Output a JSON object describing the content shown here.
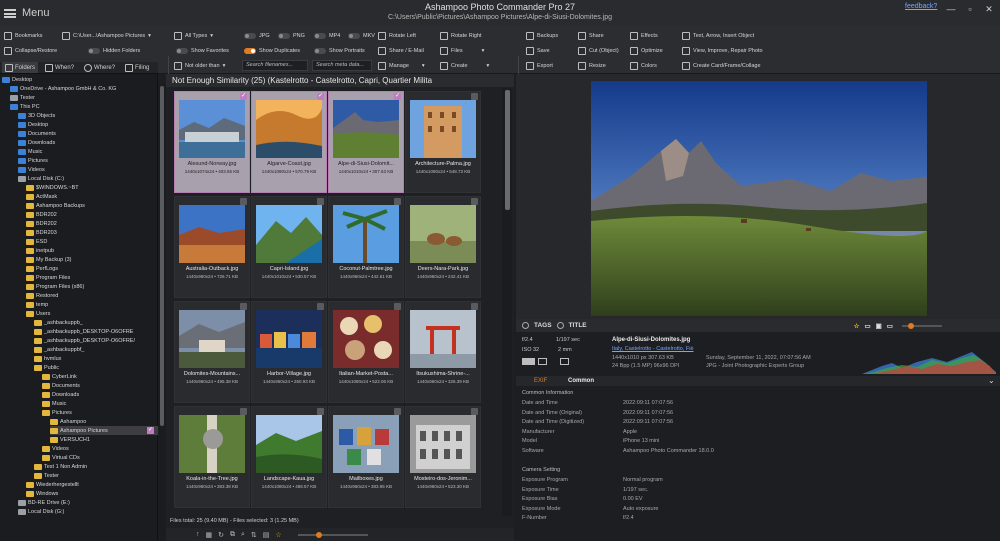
{
  "app": {
    "menu_label": "Menu",
    "title": "Ashampoo Photo Commander Pro 27",
    "path": "C:\\Users\\Public\\Pictures\\Ashampoo Pictures\\Alpe-di-Siusi-Dolomites.jpg",
    "feedback": "feedback?"
  },
  "toolbar": {
    "col1": [
      "Bookmarks",
      "Collapse/Restore"
    ],
    "col1b": [
      "C:\\User...\\Ashampoo Pictures",
      "Hidden Folders"
    ],
    "types": "All Types",
    "toggles1": [
      "JPG",
      "PNG",
      "MP4",
      "MKV"
    ],
    "show_favorites": "Show Favorites",
    "show_duplicates": "Show Duplicates",
    "show_portraits": "Show Portraits",
    "not_older_than": "Not older than",
    "search_filenames": "Search filenames...",
    "search_meta": "Search meta data...",
    "rotate_left": "Rotate Left",
    "rotate_right": "Rotate Right",
    "share_email": "Share / E-Mail",
    "files": "Files",
    "manage": "Manage",
    "create": "Create",
    "backups": "Backups",
    "share": "Share",
    "effects": "Effects",
    "save": "Save",
    "cut_object": "Cut (Object)",
    "optimize": "Optimize",
    "export": "Export",
    "resize": "Resize",
    "colors": "Colors",
    "text_arrow": "Text, Arrow, Insert Object",
    "view_improve": "View, Improve, Repair Photo",
    "create_card": "Create Card/Frame/Collage"
  },
  "tree": {
    "tabs": [
      "Folders",
      "When?",
      "Where?",
      "Filing"
    ],
    "items": [
      {
        "label": "Desktop",
        "indent": 0,
        "kind": "blue"
      },
      {
        "label": "OneDrive - Ashampoo GmbH & Co. KG",
        "indent": 1,
        "kind": "blue"
      },
      {
        "label": "Tester",
        "indent": 1,
        "kind": "gray"
      },
      {
        "label": "This PC",
        "indent": 1,
        "kind": "blue"
      },
      {
        "label": "3D Objects",
        "indent": 2,
        "kind": "blue"
      },
      {
        "label": "Desktop",
        "indent": 2,
        "kind": "blue"
      },
      {
        "label": "Documents",
        "indent": 2,
        "kind": "blue"
      },
      {
        "label": "Downloads",
        "indent": 2,
        "kind": "blue"
      },
      {
        "label": "Music",
        "indent": 2,
        "kind": "blue"
      },
      {
        "label": "Pictures",
        "indent": 2,
        "kind": "blue"
      },
      {
        "label": "Videos",
        "indent": 2,
        "kind": "blue"
      },
      {
        "label": "Local Disk (C:)",
        "indent": 2,
        "kind": "gray"
      },
      {
        "label": "$WINDOWS.~BT",
        "indent": 3,
        "kind": "yellow"
      },
      {
        "label": "ActMask",
        "indent": 3,
        "kind": "yellow"
      },
      {
        "label": "Ashampoo Backups",
        "indent": 3,
        "kind": "yellow"
      },
      {
        "label": "BDR202",
        "indent": 3,
        "kind": "yellow"
      },
      {
        "label": "BDR202",
        "indent": 3,
        "kind": "yellow"
      },
      {
        "label": "BDR203",
        "indent": 3,
        "kind": "yellow"
      },
      {
        "label": "ESD",
        "indent": 3,
        "kind": "yellow"
      },
      {
        "label": "inetpub",
        "indent": 3,
        "kind": "yellow"
      },
      {
        "label": "My Backup (3)",
        "indent": 3,
        "kind": "yellow"
      },
      {
        "label": "PerfLogs",
        "indent": 3,
        "kind": "yellow"
      },
      {
        "label": "Program Files",
        "indent": 3,
        "kind": "yellow"
      },
      {
        "label": "Program Files (x86)",
        "indent": 3,
        "kind": "yellow"
      },
      {
        "label": "Restored",
        "indent": 3,
        "kind": "yellow"
      },
      {
        "label": "temp",
        "indent": 3,
        "kind": "yellow"
      },
      {
        "label": "Users",
        "indent": 3,
        "kind": "yellow"
      },
      {
        "label": "_ashbackuppb_",
        "indent": 4,
        "kind": "yellow"
      },
      {
        "label": "_ashbackuppb_DESKTOP-O6OFRE",
        "indent": 4,
        "kind": "yellow"
      },
      {
        "label": "_ashbackuppb_DESKTOP-O6OFRE/",
        "indent": 4,
        "kind": "yellow"
      },
      {
        "label": "_ashbackuppbf_",
        "indent": 4,
        "kind": "yellow"
      },
      {
        "label": "hvmlux",
        "indent": 4,
        "kind": "yellow"
      },
      {
        "label": "Public",
        "indent": 4,
        "kind": "yellow"
      },
      {
        "label": "CyberLink",
        "indent": 5,
        "kind": "yellow"
      },
      {
        "label": "Documents",
        "indent": 5,
        "kind": "yellow"
      },
      {
        "label": "Downloads",
        "indent": 5,
        "kind": "yellow"
      },
      {
        "label": "Music",
        "indent": 5,
        "kind": "yellow"
      },
      {
        "label": "Pictures",
        "indent": 5,
        "kind": "yellow"
      },
      {
        "label": "Ashampoo",
        "indent": 6,
        "kind": "yellow"
      },
      {
        "label": "Ashampoo Pictures",
        "indent": 6,
        "kind": "yellow",
        "selected": true
      },
      {
        "label": "VERSUCH1",
        "indent": 6,
        "kind": "yellow"
      },
      {
        "label": "Videos",
        "indent": 5,
        "kind": "yellow"
      },
      {
        "label": "Virtual CDs",
        "indent": 5,
        "kind": "yellow"
      },
      {
        "label": "Test 1 Non Admin",
        "indent": 4,
        "kind": "yellow"
      },
      {
        "label": "Tester",
        "indent": 4,
        "kind": "yellow"
      },
      {
        "label": "Wiederhergestellt",
        "indent": 3,
        "kind": "yellow"
      },
      {
        "label": "Windows",
        "indent": 3,
        "kind": "yellow"
      },
      {
        "label": "BD-RE Drive (E:)",
        "indent": 2,
        "kind": "gray"
      },
      {
        "label": "Local Disk (G:)",
        "indent": 2,
        "kind": "gray"
      }
    ]
  },
  "grid": {
    "header": "Not Enough Similarity  (25)  (Kastelrotto - Castelrotto, Capri, Quartier Milita",
    "tiles": [
      {
        "name": "Alesund-Norway.jpg",
        "info": "1440x1074x24 • 403.55 KB",
        "selected": true,
        "scene": "harbor"
      },
      {
        "name": "Algarve-Coast.jpg",
        "info": "1440x1080x24 • 570.79 KB",
        "selected": true,
        "scene": "coast"
      },
      {
        "name": "Alpe-di-Siusi-Dolomit...",
        "info": "1440x1010x24 • 307.63 KB",
        "selected": true,
        "scene": "alpine"
      },
      {
        "name": "Architecture-Palma.jpg",
        "info": "1440x1080x24 • 548.73 KB",
        "selected": false,
        "scene": "building"
      },
      {
        "name": "Australia-Outback.jpg",
        "info": "1440x960x24 • 726.71 KB",
        "selected": false,
        "scene": "outback"
      },
      {
        "name": "Capri-Island.jpg",
        "info": "1440x1010x24 • 530.57 KB",
        "selected": false,
        "scene": "capri"
      },
      {
        "name": "Coconut-Palmtree.jpg",
        "info": "1440x960x24 • 442.61 KB",
        "selected": false,
        "scene": "palm"
      },
      {
        "name": "Deers-Nara-Park.jpg",
        "info": "1440x960x24 • 242.41 KB",
        "selected": false,
        "scene": "deer"
      },
      {
        "name": "Dolomites-Mountains...",
        "info": "1440x960x24 • 495.38 KB",
        "selected": false,
        "scene": "hut"
      },
      {
        "name": "Harbor-Village.jpg",
        "info": "1440x960x24 • 260.93 KB",
        "selected": false,
        "scene": "village"
      },
      {
        "name": "Italian-Market-Posta...",
        "info": "1440x1080x24 • 522.06 KB",
        "selected": false,
        "scene": "market"
      },
      {
        "name": "Itsukushima-Shrine-...",
        "info": "1440x960x24 • 326.39 KB",
        "selected": false,
        "scene": "shrine"
      },
      {
        "name": "Koala-in-the-Tree.jpg",
        "info": "1440x960x24 • 383.38 KB",
        "selected": false,
        "scene": "koala"
      },
      {
        "name": "Landscape-Kaua.jpg",
        "info": "1440x1080x24 • 488.57 KB",
        "selected": false,
        "scene": "kauai"
      },
      {
        "name": "Mailboxes.jpg",
        "info": "1440x960x24 • 383.95 KB",
        "selected": false,
        "scene": "mailbox"
      },
      {
        "name": "Mosteiro-dos-Jeronim...",
        "info": "1440x960x24 • 523.30 KB",
        "selected": false,
        "scene": "monastery"
      }
    ],
    "status": "Files total: 25 (9.40 MB) - Files selected: 3 (1.25 MB)"
  },
  "preview": {
    "tags_label": "TAGS",
    "title_label": "TITLE"
  },
  "info": {
    "aperture": "f/2.4",
    "shutter": "1/197 sec",
    "iso": "ISO 32",
    "focal": "2 mm",
    "filename": "Alpe-di-Siusi-Dolomites.jpg",
    "location": "Italy, Castelrotto - Castelrotto, Fiè",
    "dimensions": "1440x1010 px     307.63 KB",
    "bitdepth": "24 Bpp (1.5 MP)   96x96 DPI",
    "date": "Sunday, September 11, 2022, 07:07:56 AM",
    "format": "JPG - Joint Photographic Experts Group",
    "tab_exif": "EXIF",
    "tab_common": "Common",
    "sections": [
      {
        "title": "Common Information",
        "rows": [
          [
            "Date and Time",
            "2022:09:11 07:07:56"
          ],
          [
            "Date and Time (Original)",
            "2022:09:11 07:07:56"
          ],
          [
            "Date and Time (Digitized)",
            "2022:09:11 07:07:56"
          ],
          [
            "Manufacturer",
            "Apple"
          ],
          [
            "Model",
            "iPhone 13 mini"
          ],
          [
            "Software",
            "Ashampoo Photo Commander 18.0.0"
          ]
        ]
      },
      {
        "title": "Camera Setting",
        "rows": [
          [
            "Exposure Program",
            "Normal program"
          ],
          [
            "Exposure Time",
            "1/197 sec."
          ],
          [
            "Exposure Bias",
            "0.00 EV"
          ],
          [
            "Exposure Mode",
            "Auto exposure"
          ],
          [
            "F-Number",
            "f/2.4"
          ]
        ]
      }
    ]
  },
  "colors": {
    "accent": "#e07b22",
    "selection": "#c07cc0",
    "link": "#6fa8ff"
  }
}
